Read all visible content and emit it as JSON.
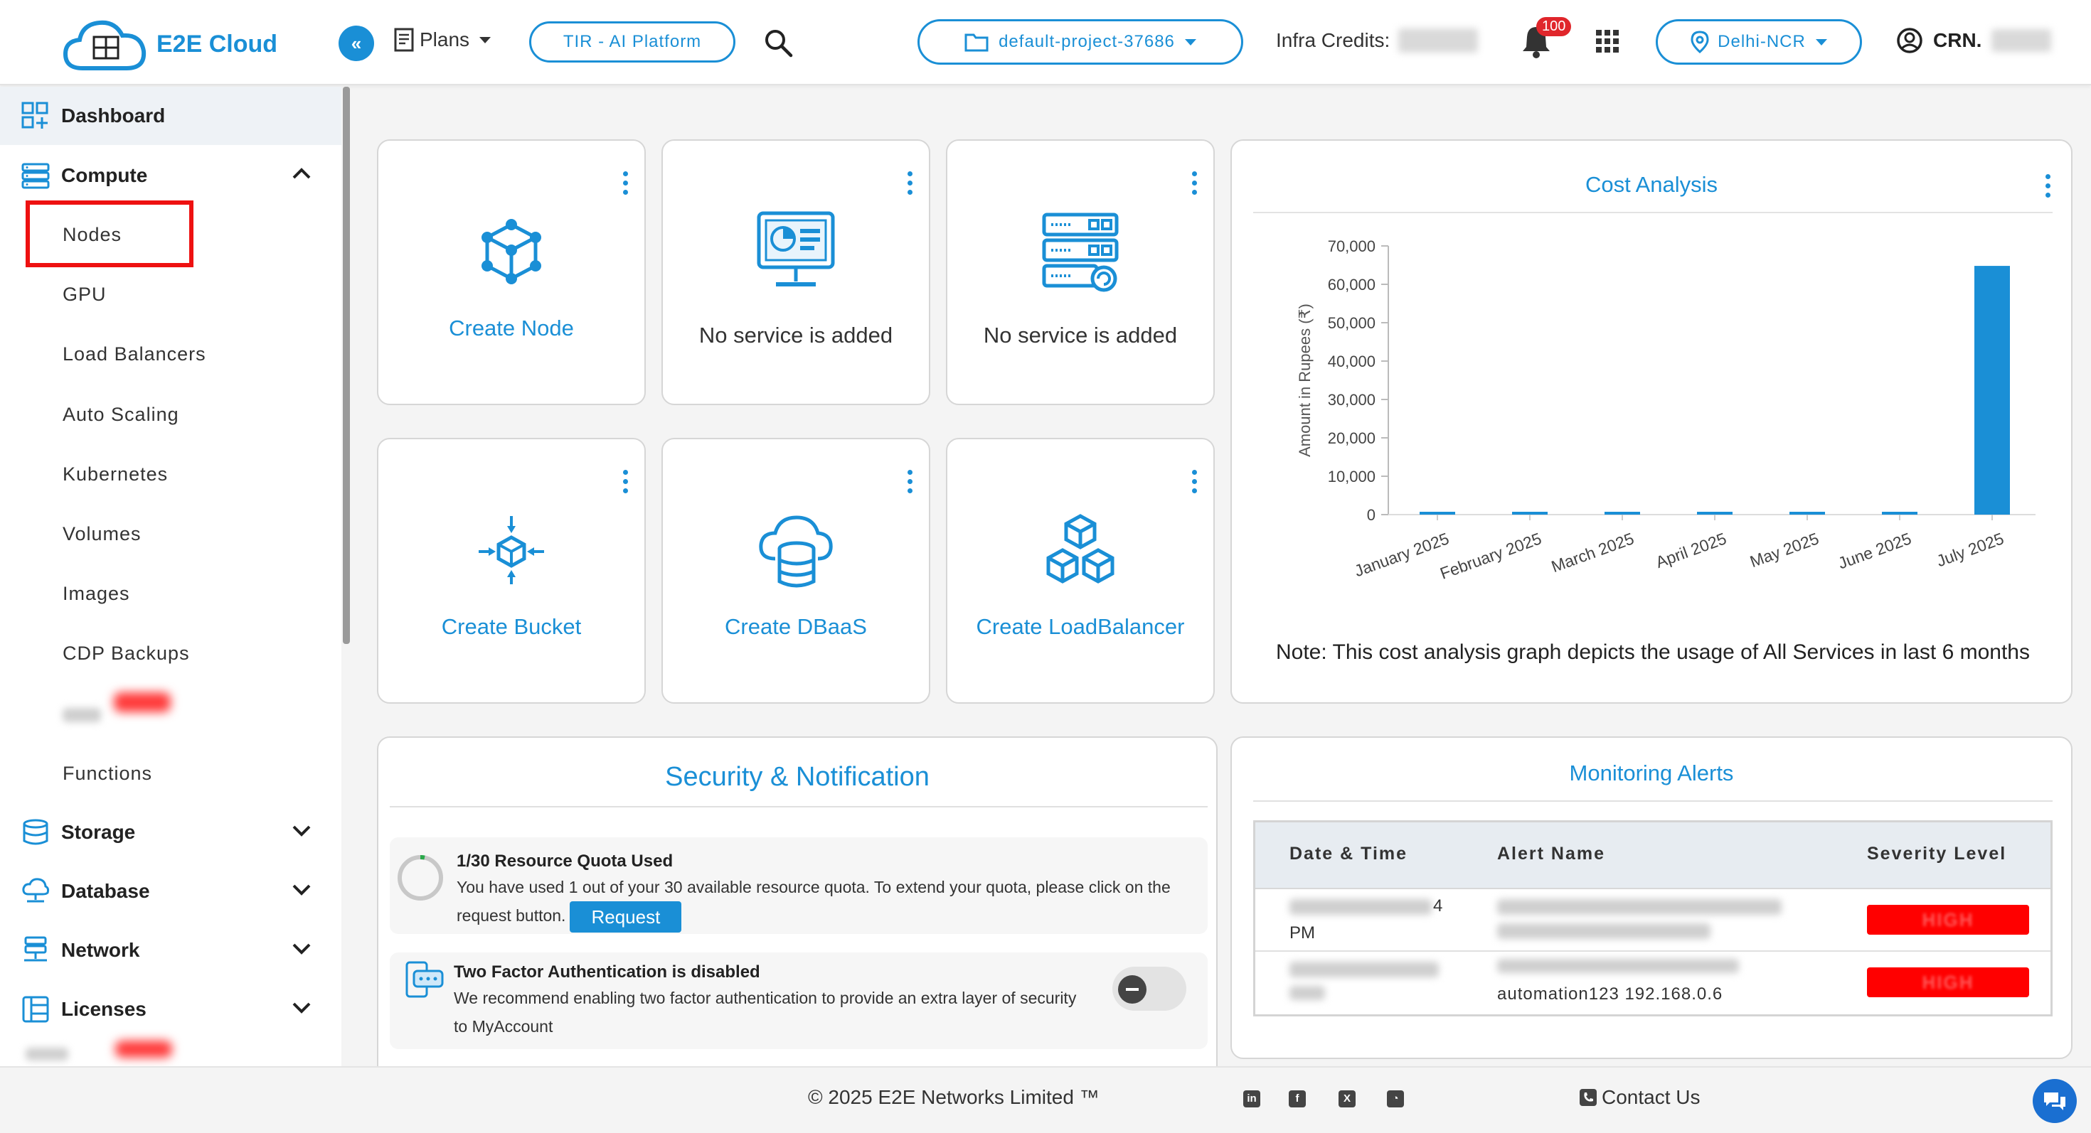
{
  "header": {
    "logo_text": "E2E Cloud",
    "logo_sub": "E2E Cloud",
    "collapse_icon": "«",
    "plans_label": "Plans",
    "tir_label": "TIR - AI Platform",
    "project_label": "default-project-37686",
    "infra_credits_label": "Infra Credits:",
    "notification_count": "100",
    "region_label": "Delhi-NCR",
    "crn_label": "CRN."
  },
  "sidebar": {
    "dashboard": "Dashboard",
    "compute": "Compute",
    "compute_items": [
      "Nodes",
      "GPU",
      "Load Balancers",
      "Auto Scaling",
      "Kubernetes",
      "Volumes",
      "Images",
      "CDP Backups"
    ],
    "functions": "Functions",
    "storage": "Storage",
    "database": "Database",
    "network": "Network",
    "licenses": "Licenses"
  },
  "cards": {
    "create_node": "Create Node",
    "no_service_1": "No service is added",
    "no_service_2": "No service is added",
    "create_bucket": "Create Bucket",
    "create_dbaas": "Create DBaaS",
    "create_loadbalancer": "Create LoadBalancer"
  },
  "cost": {
    "title": "Cost Analysis",
    "note": "Note: This cost analysis graph depicts the usage of All Services in last 6 months"
  },
  "chart_data": {
    "type": "bar",
    "title": "Cost Analysis",
    "categories": [
      "January 2025",
      "February 2025",
      "March 2025",
      "April 2025",
      "May 2025",
      "June 2025",
      "July 2025"
    ],
    "values": [
      0,
      0,
      0,
      0,
      0,
      0,
      64800
    ],
    "ylabel": "Amount in Rupees (₹)",
    "xlabel": "",
    "ylim": [
      0,
      70000
    ],
    "yticks": [
      0,
      10000,
      20000,
      30000,
      40000,
      50000,
      60000,
      70000
    ],
    "ytick_labels": [
      "0",
      "10,000",
      "20,000",
      "30,000",
      "40,000",
      "50,000",
      "60,000",
      "70,000"
    ],
    "color": "#1a8fd6",
    "grid": false
  },
  "security": {
    "title": "Security & Notification",
    "quota_title": "1/30 Resource Quota Used",
    "quota_text": "You have used 1 out of your 30 available resource quota. To extend your quota, please click on the request button.",
    "request_btn": "Request",
    "tfa_title": "Two Factor Authentication is disabled",
    "tfa_text": "We recommend enabling two factor authentication to provide an extra layer of security to MyAccount"
  },
  "monitoring": {
    "title": "Monitoring Alerts",
    "headers": [
      "Date & Time",
      "Alert Name",
      "Severity Level"
    ],
    "rows": [
      {
        "date_tail": "4",
        "date_second": "PM",
        "alert": "",
        "severity": "HIGH"
      },
      {
        "date_tail": "",
        "date_second": "",
        "alert": "automation123 192.168.0.6",
        "severity": "HIGH"
      }
    ]
  },
  "footer": {
    "copyright": "© 2025 E2E Networks Limited ™",
    "contact": "Contact Us"
  },
  "colors": {
    "accent": "#1a8fd6",
    "highlight_red": "#ee1111",
    "severity_high": "#ff0000"
  }
}
